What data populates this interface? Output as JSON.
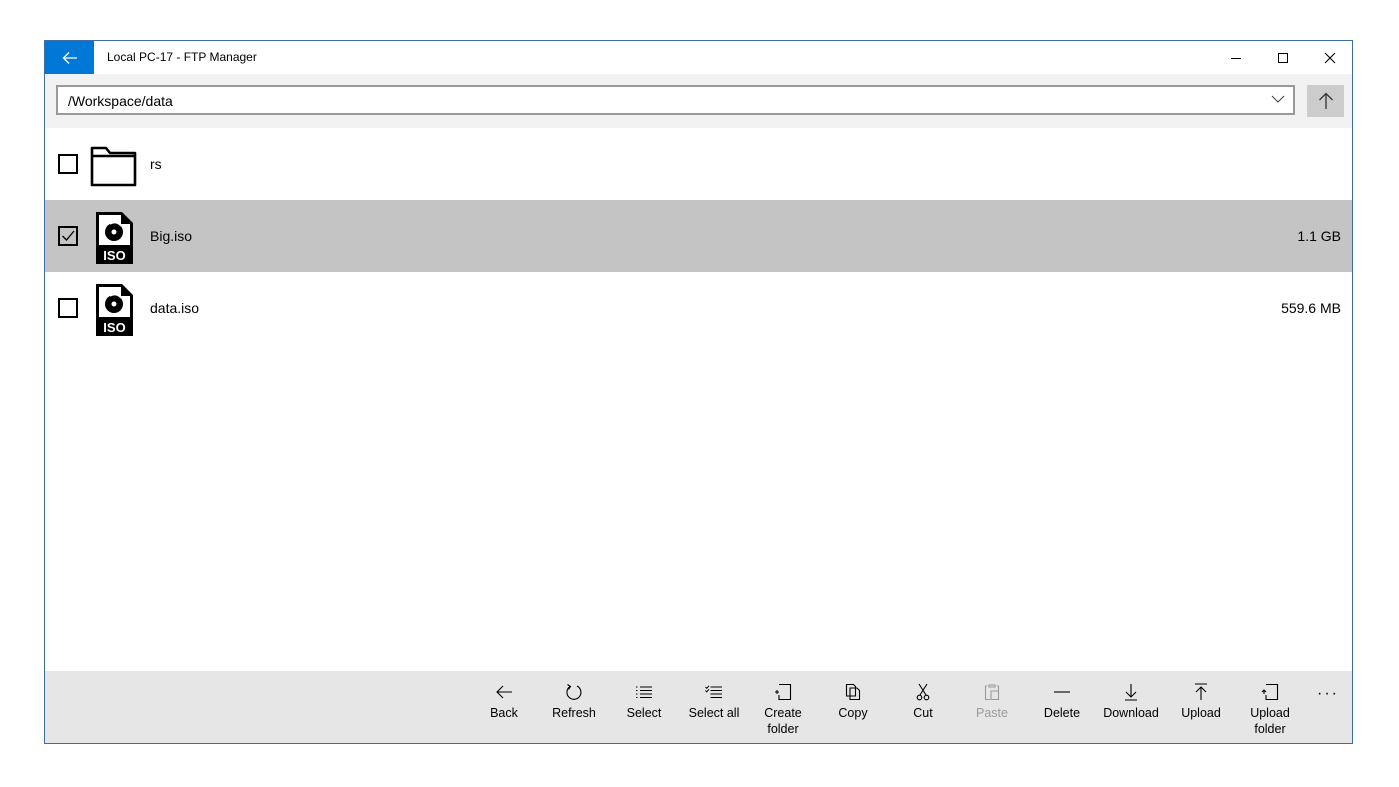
{
  "window": {
    "title": "Local PC-17 - FTP Manager"
  },
  "colors": {
    "accent": "#0078d7",
    "selected_row": "#c4c4c4",
    "cmdbar": "#e6e6e6"
  },
  "path": {
    "value": "/Workspace/data"
  },
  "files": [
    {
      "name": "rs",
      "size": "",
      "type": "folder-icon",
      "checked": false,
      "selected": false
    },
    {
      "name": "Big.iso",
      "size": "1.1 GB",
      "type": "iso-file-icon",
      "checked": true,
      "selected": true
    },
    {
      "name": "data.iso",
      "size": "559.6 MB",
      "type": "iso-file-icon",
      "checked": false,
      "selected": false
    }
  ],
  "toolbar": {
    "back": "Back",
    "refresh": "Refresh",
    "select": "Select",
    "select_all": "Select all",
    "create_folder": "Create folder",
    "copy": "Copy",
    "cut": "Cut",
    "paste": "Paste",
    "delete": "Delete",
    "download": "Download",
    "upload": "Upload",
    "upload_folder": "Upload folder",
    "more": "···"
  }
}
